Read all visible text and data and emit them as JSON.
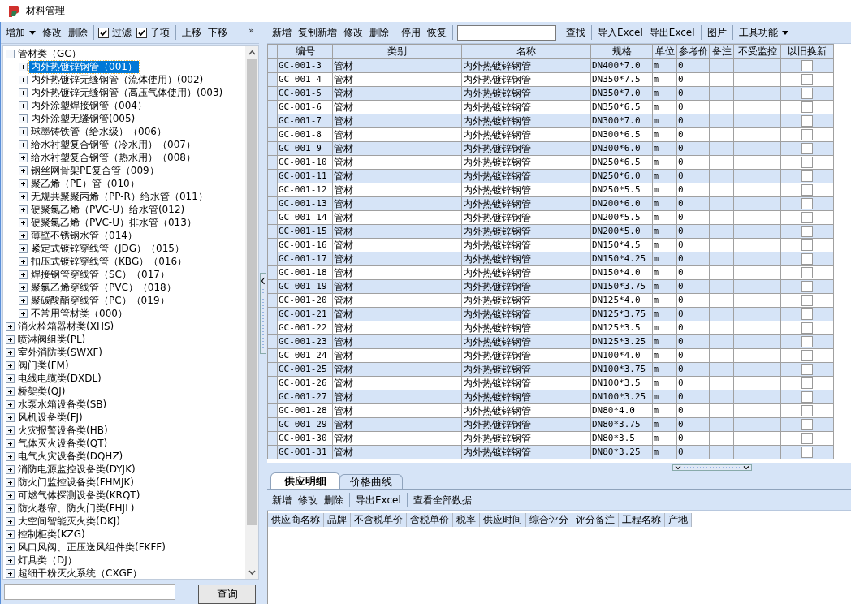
{
  "window": {
    "title": "材料管理"
  },
  "left_toolbar": [
    {
      "kind": "dropdown",
      "label": "增加"
    },
    {
      "kind": "button",
      "label": "修改"
    },
    {
      "kind": "button",
      "label": "删除"
    },
    {
      "kind": "separator"
    },
    {
      "kind": "checkbox",
      "label": "过滤",
      "checked": true
    },
    {
      "kind": "checkbox",
      "label": "子项",
      "checked": true
    },
    {
      "kind": "separator"
    },
    {
      "kind": "button",
      "label": "上移"
    },
    {
      "kind": "button",
      "label": "下移"
    },
    {
      "kind": "overflow",
      "label": "»"
    }
  ],
  "tree": [
    {
      "label": "管材类（GC）",
      "expanded": true,
      "selected": false,
      "children": [
        {
          "label": "内外热镀锌钢管（001）",
          "expanded": false,
          "selected": true
        },
        {
          "label": "内外热镀锌无缝钢管（流体使用）(002)",
          "expanded": false,
          "selected": false
        },
        {
          "label": "内外热镀锌无缝钢管（高压气体使用）(003)",
          "expanded": false,
          "selected": false
        },
        {
          "label": "内外涂塑焊接钢管（004）",
          "expanded": false,
          "selected": false
        },
        {
          "label": "内外涂塑无缝钢管(005)",
          "expanded": false,
          "selected": false
        },
        {
          "label": "球墨铸铁管（给水级）（006）",
          "expanded": false,
          "selected": false
        },
        {
          "label": "给水衬塑复合钢管（冷水用）（007）",
          "expanded": false,
          "selected": false
        },
        {
          "label": "给水衬塑复合钢管（热水用）（008）",
          "expanded": false,
          "selected": false
        },
        {
          "label": "钢丝网骨架PE复合管（009）",
          "expanded": false,
          "selected": false
        },
        {
          "label": "聚乙烯（PE）管（010）",
          "expanded": false,
          "selected": false
        },
        {
          "label": "无规共聚聚丙烯（PP-R）给水管（011）",
          "expanded": false,
          "selected": false
        },
        {
          "label": "硬聚氯乙烯（PVC-U）给水管(012)",
          "expanded": false,
          "selected": false
        },
        {
          "label": "硬聚氯乙烯（PVC-U）排水管（013）",
          "expanded": false,
          "selected": false
        },
        {
          "label": "薄壁不锈钢水管（014）",
          "expanded": false,
          "selected": false
        },
        {
          "label": "紧定式镀锌穿线管（JDG）（015）",
          "expanded": false,
          "selected": false
        },
        {
          "label": "扣压式镀锌穿线管（KBG）（016）",
          "expanded": false,
          "selected": false
        },
        {
          "label": "焊接钢管穿线管（SC）（017）",
          "expanded": false,
          "selected": false
        },
        {
          "label": "聚氯乙烯穿线管（PVC）（018）",
          "expanded": false,
          "selected": false
        },
        {
          "label": "聚碳酸酯穿线管（PC）（019）",
          "expanded": false,
          "selected": false
        },
        {
          "label": "不常用管材类（000）",
          "expanded": false,
          "selected": false
        }
      ]
    },
    {
      "label": "消火栓箱器材类(XHS)",
      "expanded": false,
      "selected": false
    },
    {
      "label": "喷淋阀组类(PL)",
      "expanded": false,
      "selected": false
    },
    {
      "label": "室外消防类(SWXF)",
      "expanded": false,
      "selected": false
    },
    {
      "label": "阀门类(FM)",
      "expanded": false,
      "selected": false
    },
    {
      "label": "电线电缆类(DXDL)",
      "expanded": false,
      "selected": false
    },
    {
      "label": "桥架类(QJ)",
      "expanded": false,
      "selected": false
    },
    {
      "label": "水泵水箱设备类(SB)",
      "expanded": false,
      "selected": false
    },
    {
      "label": "风机设备类(FJ)",
      "expanded": false,
      "selected": false
    },
    {
      "label": "火灾报警设备类(HB)",
      "expanded": false,
      "selected": false
    },
    {
      "label": "气体灭火设备类(QT)",
      "expanded": false,
      "selected": false
    },
    {
      "label": "电气火灾设备类(DQHZ)",
      "expanded": false,
      "selected": false
    },
    {
      "label": "消防电源监控设备类(DYJK)",
      "expanded": false,
      "selected": false
    },
    {
      "label": "防火门监控设备类(FHMJK)",
      "expanded": false,
      "selected": false
    },
    {
      "label": "可燃气体探测设备类(KRQT)",
      "expanded": false,
      "selected": false
    },
    {
      "label": "防火卷帘、防火门类(FHJL)",
      "expanded": false,
      "selected": false
    },
    {
      "label": "大空间智能灭火类(DKJ)",
      "expanded": false,
      "selected": false
    },
    {
      "label": "控制柜类(KZG)",
      "expanded": false,
      "selected": false
    },
    {
      "label": "风口风阀、正压送风组件类(FKFF)",
      "expanded": false,
      "selected": false
    },
    {
      "label": "灯具类（DJ）",
      "expanded": false,
      "selected": false
    },
    {
      "label": "超细干粉灭火系统（CXGF）",
      "expanded": false,
      "selected": false
    }
  ],
  "tree_search": {
    "button": "查询"
  },
  "toolbar": [
    {
      "kind": "button",
      "label": "新增"
    },
    {
      "kind": "button",
      "label": "复制新增"
    },
    {
      "kind": "button",
      "label": "修改"
    },
    {
      "kind": "button",
      "label": "删除"
    },
    {
      "kind": "separator"
    },
    {
      "kind": "button",
      "label": "停用"
    },
    {
      "kind": "button",
      "label": "恢复"
    },
    {
      "kind": "separator"
    },
    {
      "kind": "field"
    },
    {
      "kind": "button",
      "label": "查找"
    },
    {
      "kind": "separator"
    },
    {
      "kind": "button",
      "label": "导入Excel"
    },
    {
      "kind": "button",
      "label": "导出Excel"
    },
    {
      "kind": "separator"
    },
    {
      "kind": "button",
      "label": "图片"
    },
    {
      "kind": "separator"
    },
    {
      "kind": "dropdown",
      "label": "工具功能"
    }
  ],
  "table": {
    "columns": [
      "编号",
      "类别",
      "名称",
      "规格",
      "单位",
      "参考价",
      "备注",
      "不受监控",
      "以旧换新"
    ],
    "rows": [
      {
        "code": "GC-001-3",
        "category": "管材",
        "name": "内外热镀锌钢管",
        "spec": "DN400*7.0",
        "unit": "m",
        "price": "0",
        "trade_in": false
      },
      {
        "code": "GC-001-4",
        "category": "管材",
        "name": "内外热镀锌钢管",
        "spec": "DN350*7.5",
        "unit": "m",
        "price": "0",
        "trade_in": false
      },
      {
        "code": "GC-001-5",
        "category": "管材",
        "name": "内外热镀锌钢管",
        "spec": "DN350*7.0",
        "unit": "m",
        "price": "0",
        "trade_in": false
      },
      {
        "code": "GC-001-6",
        "category": "管材",
        "name": "内外热镀锌钢管",
        "spec": "DN350*6.5",
        "unit": "m",
        "price": "0",
        "trade_in": false
      },
      {
        "code": "GC-001-7",
        "category": "管材",
        "name": "内外热镀锌钢管",
        "spec": "DN300*7.0",
        "unit": "m",
        "price": "0",
        "trade_in": false
      },
      {
        "code": "GC-001-8",
        "category": "管材",
        "name": "内外热镀锌钢管",
        "spec": "DN300*6.5",
        "unit": "m",
        "price": "0",
        "trade_in": false
      },
      {
        "code": "GC-001-9",
        "category": "管材",
        "name": "内外热镀锌钢管",
        "spec": "DN300*6.0",
        "unit": "m",
        "price": "0",
        "trade_in": false
      },
      {
        "code": "GC-001-10",
        "category": "管材",
        "name": "内外热镀锌钢管",
        "spec": "DN250*6.5",
        "unit": "m",
        "price": "0",
        "trade_in": false
      },
      {
        "code": "GC-001-11",
        "category": "管材",
        "name": "内外热镀锌钢管",
        "spec": "DN250*6.0",
        "unit": "m",
        "price": "0",
        "trade_in": false
      },
      {
        "code": "GC-001-12",
        "category": "管材",
        "name": "内外热镀锌钢管",
        "spec": "DN250*5.5",
        "unit": "m",
        "price": "0",
        "trade_in": false
      },
      {
        "code": "GC-001-13",
        "category": "管材",
        "name": "内外热镀锌钢管",
        "spec": "DN200*6.0",
        "unit": "m",
        "price": "0",
        "trade_in": false
      },
      {
        "code": "GC-001-14",
        "category": "管材",
        "name": "内外热镀锌钢管",
        "spec": "DN200*5.5",
        "unit": "m",
        "price": "0",
        "trade_in": false
      },
      {
        "code": "GC-001-15",
        "category": "管材",
        "name": "内外热镀锌钢管",
        "spec": "DN200*5.0",
        "unit": "m",
        "price": "0",
        "trade_in": false
      },
      {
        "code": "GC-001-16",
        "category": "管材",
        "name": "内外热镀锌钢管",
        "spec": "DN150*4.5",
        "unit": "m",
        "price": "0",
        "trade_in": false
      },
      {
        "code": "GC-001-17",
        "category": "管材",
        "name": "内外热镀锌钢管",
        "spec": "DN150*4.25",
        "unit": "m",
        "price": "0",
        "trade_in": false
      },
      {
        "code": "GC-001-18",
        "category": "管材",
        "name": "内外热镀锌钢管",
        "spec": "DN150*4.0",
        "unit": "m",
        "price": "0",
        "trade_in": false
      },
      {
        "code": "GC-001-19",
        "category": "管材",
        "name": "内外热镀锌钢管",
        "spec": "DN150*3.75",
        "unit": "m",
        "price": "0",
        "trade_in": false
      },
      {
        "code": "GC-001-20",
        "category": "管材",
        "name": "内外热镀锌钢管",
        "spec": "DN125*4.0",
        "unit": "m",
        "price": "0",
        "trade_in": false
      },
      {
        "code": "GC-001-21",
        "category": "管材",
        "name": "内外热镀锌钢管",
        "spec": "DN125*3.75",
        "unit": "m",
        "price": "0",
        "trade_in": false
      },
      {
        "code": "GC-001-22",
        "category": "管材",
        "name": "内外热镀锌钢管",
        "spec": "DN125*3.5",
        "unit": "m",
        "price": "0",
        "trade_in": false
      },
      {
        "code": "GC-001-23",
        "category": "管材",
        "name": "内外热镀锌钢管",
        "spec": "DN125*3.25",
        "unit": "m",
        "price": "0",
        "trade_in": false
      },
      {
        "code": "GC-001-24",
        "category": "管材",
        "name": "内外热镀锌钢管",
        "spec": "DN100*4.0",
        "unit": "m",
        "price": "0",
        "trade_in": false
      },
      {
        "code": "GC-001-25",
        "category": "管材",
        "name": "内外热镀锌钢管",
        "spec": "DN100*3.75",
        "unit": "m",
        "price": "0",
        "trade_in": false
      },
      {
        "code": "GC-001-26",
        "category": "管材",
        "name": "内外热镀锌钢管",
        "spec": "DN100*3.5",
        "unit": "m",
        "price": "0",
        "trade_in": false
      },
      {
        "code": "GC-001-27",
        "category": "管材",
        "name": "内外热镀锌钢管",
        "spec": "DN100*3.25",
        "unit": "m",
        "price": "0",
        "trade_in": false
      },
      {
        "code": "GC-001-28",
        "category": "管材",
        "name": "内外热镀锌钢管",
        "spec": "DN80*4.0",
        "unit": "m",
        "price": "0",
        "trade_in": false
      },
      {
        "code": "GC-001-29",
        "category": "管材",
        "name": "内外热镀锌钢管",
        "spec": "DN80*3.75",
        "unit": "m",
        "price": "0",
        "trade_in": false
      },
      {
        "code": "GC-001-30",
        "category": "管材",
        "name": "内外热镀锌钢管",
        "spec": "DN80*3.5",
        "unit": "m",
        "price": "0",
        "trade_in": false
      },
      {
        "code": "GC-001-31",
        "category": "管材",
        "name": "内外热镀锌钢管",
        "spec": "DN80*3.25",
        "unit": "m",
        "price": "0",
        "trade_in": false
      }
    ]
  },
  "detail": {
    "tabs": [
      {
        "label": "供应明细",
        "selected": true
      },
      {
        "label": "价格曲线",
        "selected": false
      }
    ],
    "toolbar": [
      {
        "kind": "button",
        "label": "新增"
      },
      {
        "kind": "button",
        "label": "修改"
      },
      {
        "kind": "button",
        "label": "删除"
      },
      {
        "kind": "separator"
      },
      {
        "kind": "button",
        "label": "导出Excel"
      },
      {
        "kind": "separator"
      },
      {
        "kind": "button",
        "label": "查看全部数据"
      }
    ],
    "columns": [
      "供应商名称",
      "品牌",
      "不含税单价",
      "含税单价",
      "税率",
      "供应时间",
      "综合评分",
      "评分备注",
      "工程名称",
      "产地"
    ]
  }
}
